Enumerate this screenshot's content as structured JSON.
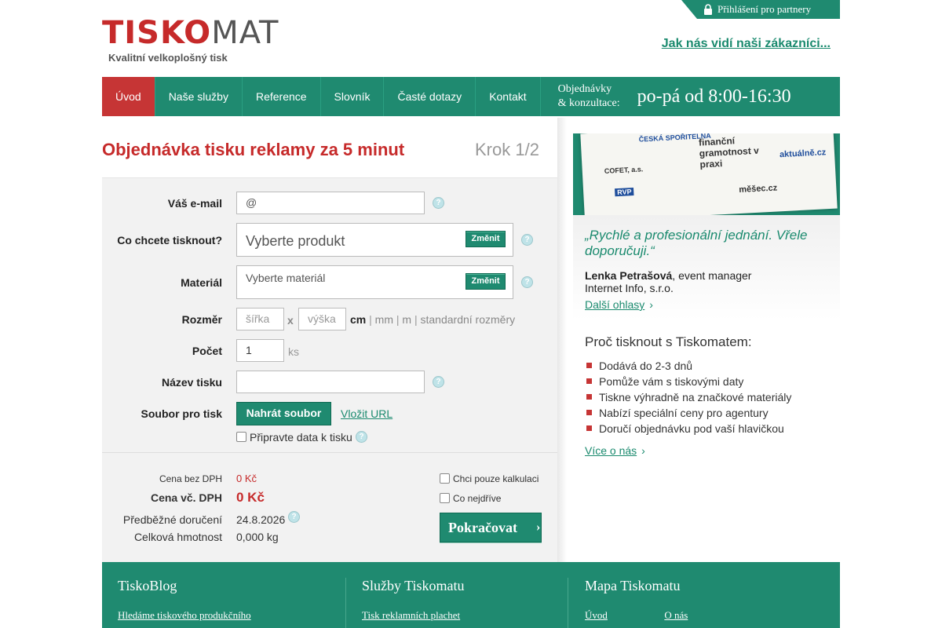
{
  "header": {
    "logo_main_red": "TISKO",
    "logo_main_grey": "MAT",
    "logo_tagline": "Kvalitní velkoplošný tisk",
    "partner_login": "Přihlášení pro partnery",
    "customers_link": "Jak nás vidí naši zákazníci..."
  },
  "nav": {
    "items": [
      {
        "label": "Úvod"
      },
      {
        "label": "Naše služby"
      },
      {
        "label": "Reference"
      },
      {
        "label": "Slovník"
      },
      {
        "label": "Časté dotazy"
      },
      {
        "label": "Kontakt"
      }
    ],
    "hours_label_1": "Objednávky",
    "hours_label_2": "& konzultace:",
    "hours": "po-pá od 8:00-16:30"
  },
  "form": {
    "title": "Objednávka tisku reklamy za 5 minut",
    "step": "Krok 1/2",
    "email_label": "Váš e-mail",
    "email_value": "@",
    "product_label": "Co chcete tisknout?",
    "product_placeholder": "Vyberte produkt",
    "material_label": "Materiál",
    "material_placeholder": "Vyberte materiál",
    "change_label": "Změnit",
    "size_label": "Rozměr",
    "width_placeholder": "šířka",
    "height_placeholder": "výška",
    "size_x": "x",
    "unit_cm": "cm",
    "unit_mm": "mm",
    "unit_m": "m",
    "standard_sizes": "standardní rozměry",
    "sep": "|",
    "count_label": "Počet",
    "count_value": "1",
    "count_unit": "ks",
    "print_name_label": "Název tisku",
    "file_label": "Soubor pro tisk",
    "upload_button": "Nahrát soubor",
    "insert_url": "Vložit URL",
    "prepare_data": "Připravte data k tisku",
    "help_glyph": "?"
  },
  "pricing": {
    "price_ex_vat_label": "Cena bez DPH",
    "price_ex_vat": "0 Kč",
    "price_inc_vat_label": "Cena vč. DPH",
    "price_inc_vat": "0 Kč",
    "delivery_label": "Předběžné doručení",
    "delivery_date": "24.8.2026",
    "weight_label": "Celková hmotnost",
    "weight": "0,000 kg",
    "only_calc": "Chci pouze kalkulaci",
    "asap": "Co nejdříve",
    "continue_button": "Pokračovat",
    "continue_arrow": "›"
  },
  "sidebar": {
    "banner": {
      "b1": "ČESKÁ SPOŘITELNA",
      "b2": "finanční gramotnost v praxi",
      "b3": "aktuálně.cz",
      "b4": "COFET, a.s.",
      "b5": "RVP",
      "b6": "měšec.cz"
    },
    "quote": "„Rychlé a profesionální jednání. Vřele doporučuji.“",
    "author_name": "Lenka Petrašová",
    "author_role": ", event manager",
    "author_company": "Internet Info, s.r.o.",
    "more_reviews": "Další ohlasy",
    "why_title": "Proč tisknout s Tiskomatem:",
    "why_items": [
      "Dodává do 2-3 dnů",
      "Pomůže vám s tiskovými daty",
      "Tiskne výhradně na značkové materiály",
      "Nabízí speciální ceny pro agentury",
      "Doručí objednávku pod vaší hlavičkou"
    ],
    "about_link": "Více o nás",
    "chevron": "›"
  },
  "footer": {
    "col1_title": "TiskoBlog",
    "col1_link": "Hledáme tiskového produkčního",
    "col2_title": "Služby Tiskomatu",
    "col2_link": "Tisk reklamních plachet",
    "col3_title": "Mapa Tiskomatu",
    "col3_link1": "Úvod",
    "col3_link2": "O nás"
  },
  "colors": {
    "brand_green": "#1f8a70",
    "brand_red": "#c62a2a",
    "link_green": "#1a8a6e"
  }
}
